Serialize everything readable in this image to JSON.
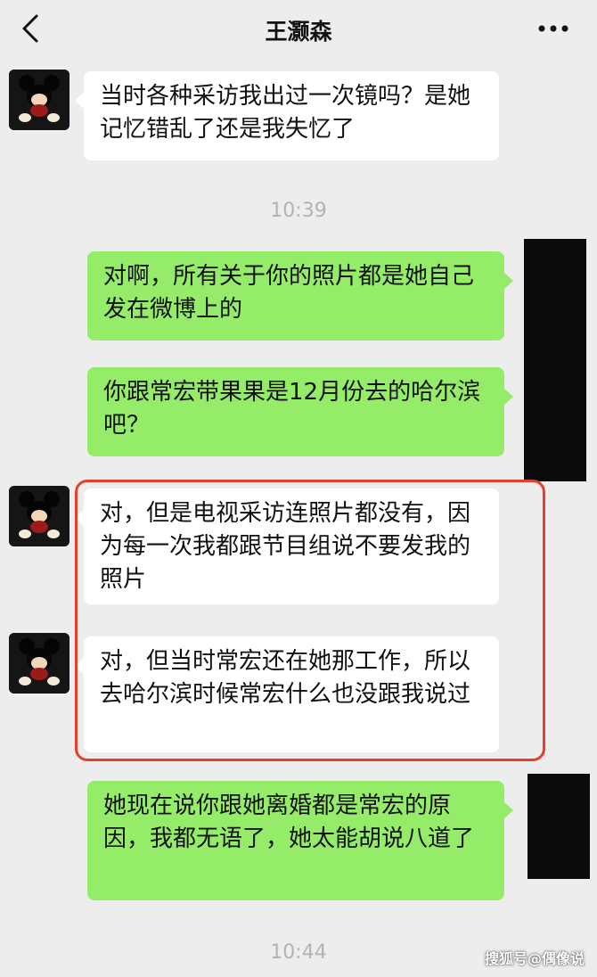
{
  "header": {
    "title": "王灏森",
    "back_icon": "chevron-left-icon",
    "more_icon": "more-dots-icon"
  },
  "messages": [
    {
      "side": "left",
      "text": "当时各种采访我出过一次镜吗？是她记忆错乱了还是我失忆了"
    },
    {
      "side": "time",
      "text": "10:39"
    },
    {
      "side": "right",
      "text": "对啊，所有关于你的照片都是她自己发在微博上的"
    },
    {
      "side": "right",
      "text": "你跟常宏带果果是12月份去的哈尔滨吧？"
    },
    {
      "side": "left",
      "text": "对，但是电视采访连照片都没有，因为每一次我都跟节目组说不要发我的照片"
    },
    {
      "side": "left",
      "text": "对，但当时常宏还在她那工作，所以去哈尔滨时候常宏什么也没跟我说过"
    },
    {
      "side": "right",
      "text": "她现在说你跟她离婚都是常宏的原因，我都无语了，她太能胡说八道了"
    },
    {
      "side": "time",
      "text": "10:44"
    }
  ],
  "watermark": "搜狐号@偶像说",
  "colors": {
    "background": "#ededed",
    "sent_bubble": "#95ec69",
    "received_bubble": "#ffffff",
    "highlight_border": "#e63f2a"
  }
}
